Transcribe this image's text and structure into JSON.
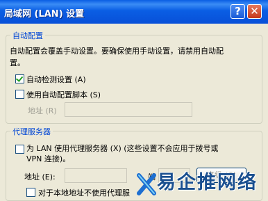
{
  "window": {
    "title": "局域网 (LAN) 设置",
    "help_glyph": "?",
    "close_glyph": "✕"
  },
  "auto_config": {
    "legend": "自动配置",
    "description_line1": "自动配置会覆盖手动设置。要确保使用手动设置，请禁用自动配",
    "description_line2": "置。",
    "auto_detect_label": "自动检测设置 (A)",
    "auto_detect_checked": true,
    "use_script_label": "使用自动配置脚本 (S)",
    "use_script_checked": false,
    "address_label": "地址 (R)",
    "address_value": ""
  },
  "proxy": {
    "legend": "代理服务器",
    "use_proxy_label_line1": "为 LAN 使用代理服务器 (X) (这些设置不会应用于拨号或",
    "use_proxy_label_line2": "VPN 连接)。",
    "use_proxy_checked": false,
    "address_label": "地址 (E):",
    "address_value": "",
    "port_label": "端",
    "port_value": "",
    "advanced_label": "高级 (C)",
    "bypass_label": "对于本地地址不使用代理服",
    "bypass_checked": false
  },
  "watermark": {
    "text": "易企推网络"
  }
}
